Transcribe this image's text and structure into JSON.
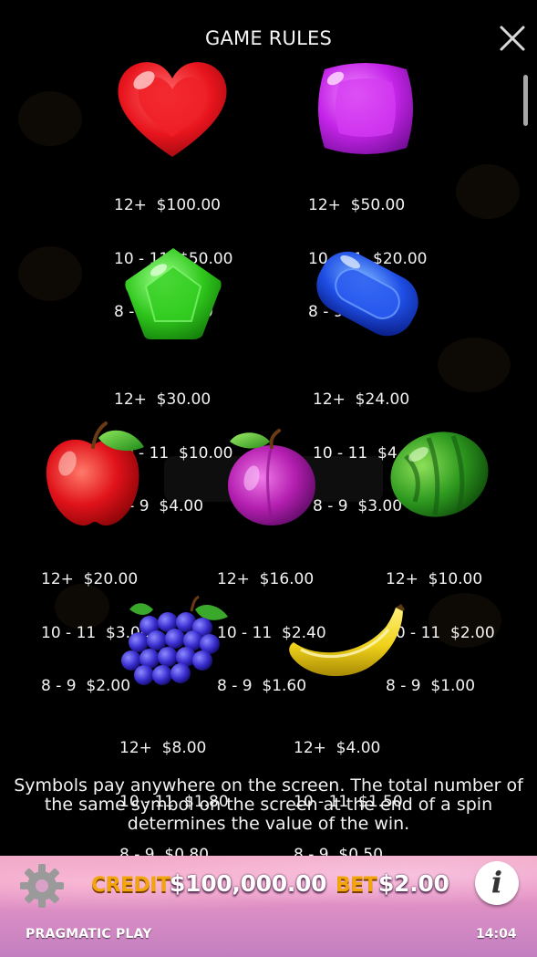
{
  "header": {
    "title": "GAME RULES"
  },
  "symbols": [
    {
      "name": "heart",
      "icon": "red-heart-candy",
      "lines": [
        "12+  $100.00",
        "10 - 11  $50.00",
        "8 - 9  $20.00"
      ]
    },
    {
      "name": "square",
      "icon": "purple-square-candy",
      "lines": [
        "12+  $50.00",
        "10 - 11  $20.00",
        "8 - 9  $5.00"
      ]
    },
    {
      "name": "pentagon",
      "icon": "green-pentagon-candy",
      "lines": [
        "12+  $30.00",
        "10 - 11  $10.00",
        "8 - 9  $4.00"
      ]
    },
    {
      "name": "oblong",
      "icon": "blue-oblong-candy",
      "lines": [
        "12+  $24.00",
        "10 - 11  $4.00",
        "8 - 9  $3.00"
      ]
    },
    {
      "name": "apple",
      "icon": "red-apple",
      "lines": [
        "12+  $20.00",
        "10 - 11  $3.00",
        "8 - 9  $2.00"
      ]
    },
    {
      "name": "plum",
      "icon": "purple-plum",
      "lines": [
        "12+  $16.00",
        "10 - 11  $2.40",
        "8 - 9  $1.60"
      ]
    },
    {
      "name": "watermelon",
      "icon": "green-watermelon",
      "lines": [
        "12+  $10.00",
        "10 - 11  $2.00",
        "8 - 9  $1.00"
      ]
    },
    {
      "name": "grapes",
      "icon": "purple-grapes",
      "lines": [
        "12+  $8.00",
        "10 - 11  $1.80",
        "8 - 9  $0.80"
      ]
    },
    {
      "name": "banana",
      "icon": "yellow-banana",
      "lines": [
        "12+  $4.00",
        "10 - 11  $1.50",
        "8 - 9  $0.50"
      ]
    }
  ],
  "rules_text": "Symbols pay anywhere on the screen. The total number of the same symbol on the screen at the end of a spin determines the value of the win.",
  "bottom_bar": {
    "credit_label": "CREDIT",
    "credit_value": "$100,000.00",
    "bet_label": "BET",
    "bet_value": "$2.00",
    "info_label": "i",
    "brand": "PRAGMATIC PLAY",
    "time": "14:04"
  },
  "colors": {
    "accent_orange": "#f2a50c",
    "bar_pink": "#e995c4"
  }
}
